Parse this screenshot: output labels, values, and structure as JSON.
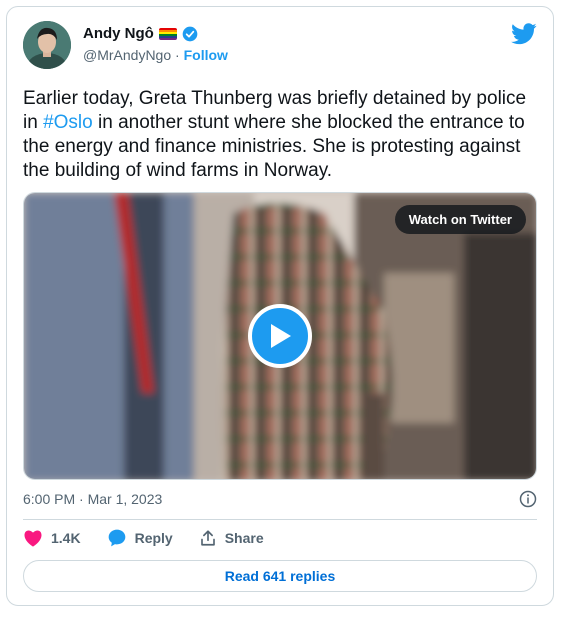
{
  "author": {
    "name": "Andy Ngô",
    "handle": "@MrAndyNgo",
    "separator": " · ",
    "follow_label": "Follow"
  },
  "tweet": {
    "text_before": "Earlier today, Greta Thunberg was briefly detained by police in ",
    "hashtag": "#Oslo",
    "text_after": " in another stunt where she blocked the entrance to the energy and finance ministries. She is protesting against the building of wind farms in Norway."
  },
  "media": {
    "watch_label": "Watch on Twitter"
  },
  "timestamp": "6:00 PM · Mar 1, 2023",
  "actions": {
    "likes": "1.4K",
    "reply_label": "Reply",
    "share_label": "Share"
  },
  "read_replies_label": "Read 641 replies",
  "colors": {
    "accent": "#1d9bf0",
    "like": "#f91880",
    "link_button": "#006fd6",
    "muted": "#536471"
  }
}
